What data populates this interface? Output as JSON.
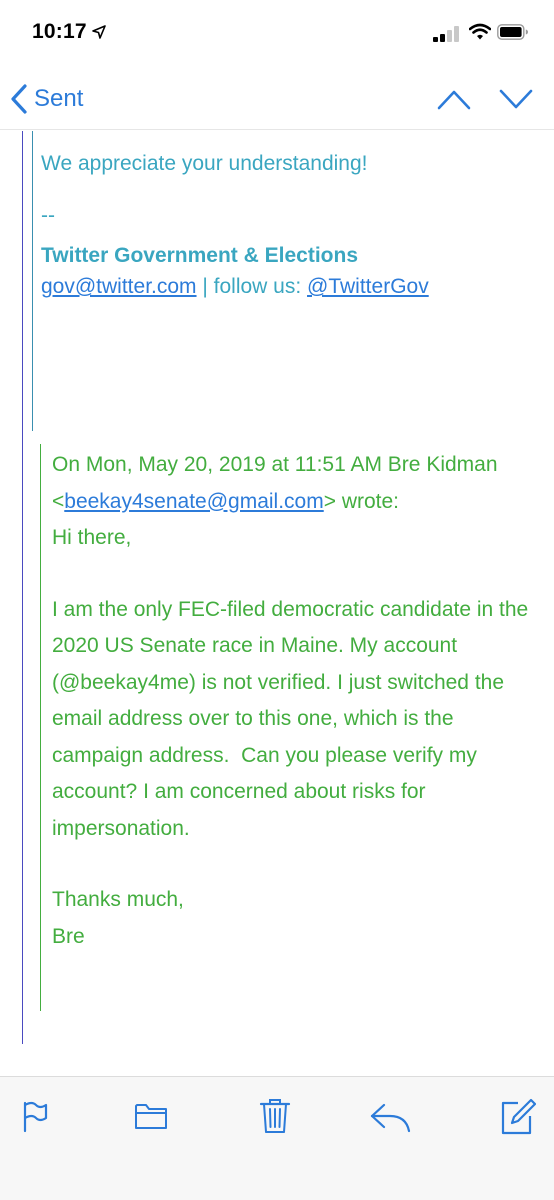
{
  "status_bar": {
    "time": "10:17",
    "icons": [
      "location-arrow-icon",
      "cellular-signal-icon",
      "wifi-icon",
      "battery-icon"
    ]
  },
  "nav": {
    "back_label": "Sent",
    "icons": [
      "chevron-left-icon",
      "chevron-up-icon",
      "chevron-down-icon"
    ]
  },
  "message": {
    "appreciation": "We appreciate your understanding!",
    "signature_dash": "--",
    "signature_title": "Twitter Government & Elections",
    "signature_email": "gov@twitter.com",
    "signature_separator": " | follow us: ",
    "signature_handle": "@TwitterGov",
    "quoted": {
      "header_prefix": "On Mon, May 20, 2019 at 11:51 AM Bre Kidman <",
      "header_email": "beekay4senate@gmail.com",
      "header_suffix": "> wrote:",
      "greeting": "Hi there,",
      "body": "I am the only FEC-filed democratic candidate in the 2020 US Senate race in Maine. My account (@beekay4me) is not verified. I just switched the email address over to this one, which is the campaign address.  Can you please verify my account? I am concerned about risks for impersonation.",
      "closing": "Thanks much,",
      "name": "Bre"
    }
  },
  "toolbar": {
    "icons": [
      "flag-icon",
      "folder-icon",
      "trash-icon",
      "reply-icon",
      "compose-icon"
    ]
  },
  "colors": {
    "accent_blue": "#2c7bd9",
    "teal_text": "#3aa6c0",
    "green_text": "#43ad3f",
    "quote_line_outer": "#4a4ac0"
  }
}
